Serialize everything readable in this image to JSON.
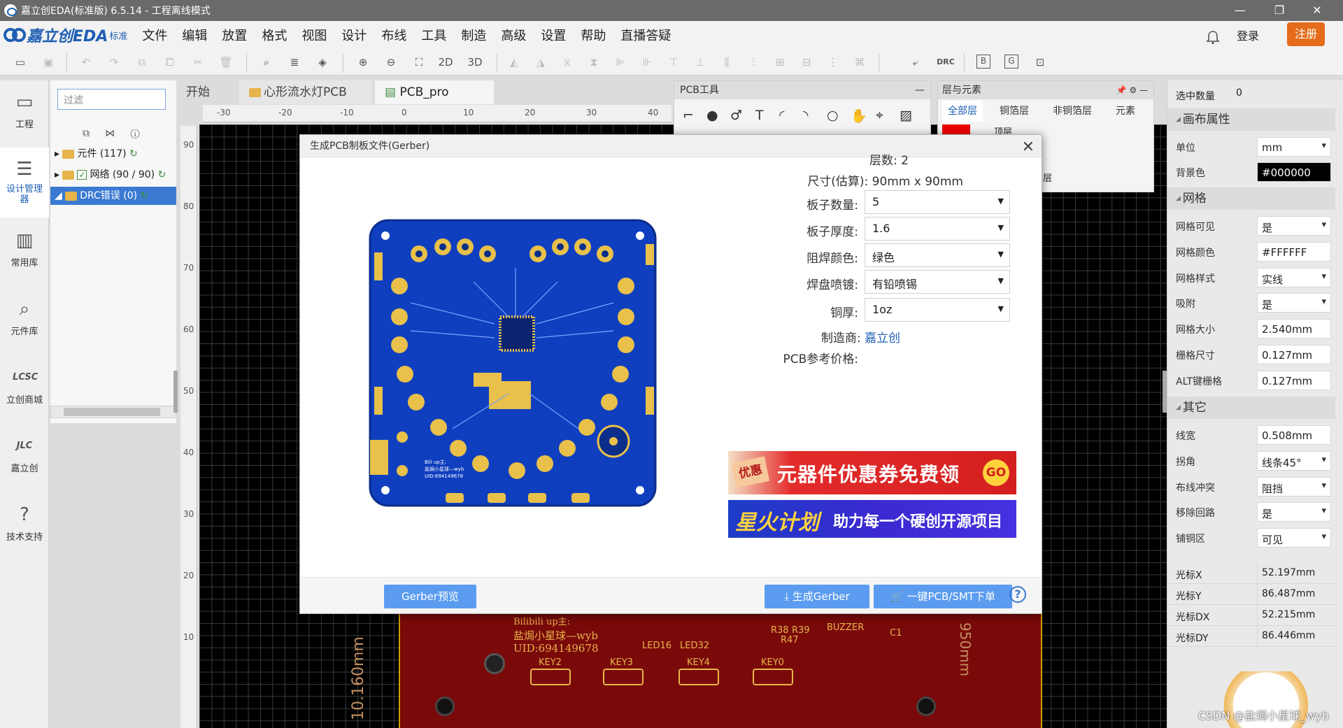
{
  "window": {
    "title": "嘉立创EDA(标准版) 6.5.14 - 工程离线模式",
    "controls": [
      "minimize",
      "restore",
      "close"
    ]
  },
  "brand": {
    "name": "嘉立创EDA",
    "edition": "标准"
  },
  "menu": [
    "文件",
    "编辑",
    "放置",
    "格式",
    "视图",
    "设计",
    "布线",
    "工具",
    "制造",
    "高级",
    "设置",
    "帮助",
    "直播答疑"
  ],
  "account": {
    "login": "登录",
    "register": "注册"
  },
  "toolbar": {
    "btn_2d": "2D",
    "btn_3d": "3D",
    "btn_drc": "DRC",
    "btn_b": "B",
    "btn_g": "G"
  },
  "leftnav": [
    {
      "label": "工程",
      "icon": "folder-icon"
    },
    {
      "label": "设计管理器",
      "icon": "list-icon"
    },
    {
      "label": "常用库",
      "icon": "chip-icon"
    },
    {
      "label": "元件库",
      "icon": "search-chip-icon"
    },
    {
      "label": "立创商城",
      "icon": "lcsc-icon"
    },
    {
      "label": "嘉立创",
      "icon": "jlc-icon"
    },
    {
      "label": "技术支持",
      "icon": "help-icon"
    }
  ],
  "design_manager": {
    "filter_placeholder": "过滤",
    "rows": [
      "元件 (117)",
      "网络 (90 / 90)",
      "DRC错误 (0)"
    ]
  },
  "tabs": [
    "开始",
    "心形流水灯PCB",
    "PCB_pro"
  ],
  "ruler": {
    "h": [
      "-30",
      "-20",
      "-10",
      "0",
      "10",
      "20",
      "30",
      "40"
    ],
    "v": [
      "90",
      "80",
      "70",
      "60",
      "50",
      "40",
      "30",
      "20",
      "10"
    ]
  },
  "pcb_tools": {
    "title": "PCB工具"
  },
  "layers": {
    "title": "层与元素",
    "tabs": [
      "全部层",
      "铜箔层",
      "非铜箔层",
      "元素"
    ],
    "row_label": "顶层",
    "row_label2": "层"
  },
  "props": {
    "selected_count_label": "选中数量",
    "selected_count": "0",
    "section_canvas": "画布属性",
    "unit_label": "单位",
    "unit_value": "mm",
    "bg_label": "背景色",
    "bg_value": "#000000",
    "section_grid": "网格",
    "grid_rows": [
      {
        "label": "网格可见",
        "value": "是",
        "select": true
      },
      {
        "label": "网格颜色",
        "value": "#FFFFFF",
        "select": false
      },
      {
        "label": "网格样式",
        "value": "实线",
        "select": true
      },
      {
        "label": "吸附",
        "value": "是",
        "select": true
      },
      {
        "label": "网格大小",
        "value": "2.540mm",
        "select": false
      },
      {
        "label": "栅格尺寸",
        "value": "0.127mm",
        "select": false
      },
      {
        "label": "ALT键栅格",
        "value": "0.127mm",
        "select": false
      }
    ],
    "section_other": "其它",
    "other_rows": [
      {
        "label": "线宽",
        "value": "0.508mm",
        "select": false
      },
      {
        "label": "拐角",
        "value": "线条45°",
        "select": true
      },
      {
        "label": "布线冲突",
        "value": "阻挡",
        "select": true
      },
      {
        "label": "移除回路",
        "value": "是",
        "select": true
      },
      {
        "label": "铺铜区",
        "value": "可见",
        "select": true
      }
    ],
    "cursor_rows": [
      {
        "label": "光标X",
        "value": "52.197mm"
      },
      {
        "label": "光标Y",
        "value": "86.487mm"
      },
      {
        "label": "光标DX",
        "value": "52.215mm"
      },
      {
        "label": "光标DY",
        "value": "86.446mm"
      }
    ]
  },
  "modal": {
    "title": "生成PCB制板文件(Gerber)",
    "layers_label": "层数:",
    "layers_value": "2",
    "size_label": "尺寸(估算):",
    "size_value": "90mm x 90mm",
    "qty_label": "板子数量:",
    "qty_value": "5",
    "thick_label": "板子厚度:",
    "thick_value": "1.6",
    "mask_label": "阻焊颜色:",
    "mask_value": "绿色",
    "finish_label": "焊盘喷镀:",
    "finish_value": "有铅喷锡",
    "copper_label": "铜厚:",
    "copper_value": "1oz",
    "maker_label": "制造商:",
    "maker_value": "嘉立创",
    "price_label": "PCB参考价格:",
    "banner1_tag": "优惠",
    "banner1_text": "元器件优惠券免费领",
    "banner1_go": "GO",
    "banner2_a": "星火计划",
    "banner2_b": "助力每一个硬创开源项目",
    "btn_preview": "Gerber预览",
    "btn_generate": "生成Gerber",
    "btn_order": "一键PCB/SMT下单"
  },
  "board_labels": {
    "bili": "Bilibili up主:",
    "author": "盐焗小星球—wyb",
    "uid": "UID:694149678",
    "led16": "LED16",
    "led32": "LED32",
    "r38": "R38",
    "r39": "R39",
    "r47": "R47",
    "buzzer": "BUZZER",
    "c1": "C1",
    "key2": "KEY2",
    "key3": "KEY3",
    "key4": "KEY4",
    "key0": "KEY0",
    "dim_v": "10.160mm",
    "dim_r": "950mm"
  },
  "watermark": "CSDN @盐焗小星球_wyb",
  "colors": {
    "accent": "#1e5fb4",
    "register": "#e46c1b",
    "button": "#5b9cf0",
    "pcb_blue": "#0f3fbf"
  }
}
